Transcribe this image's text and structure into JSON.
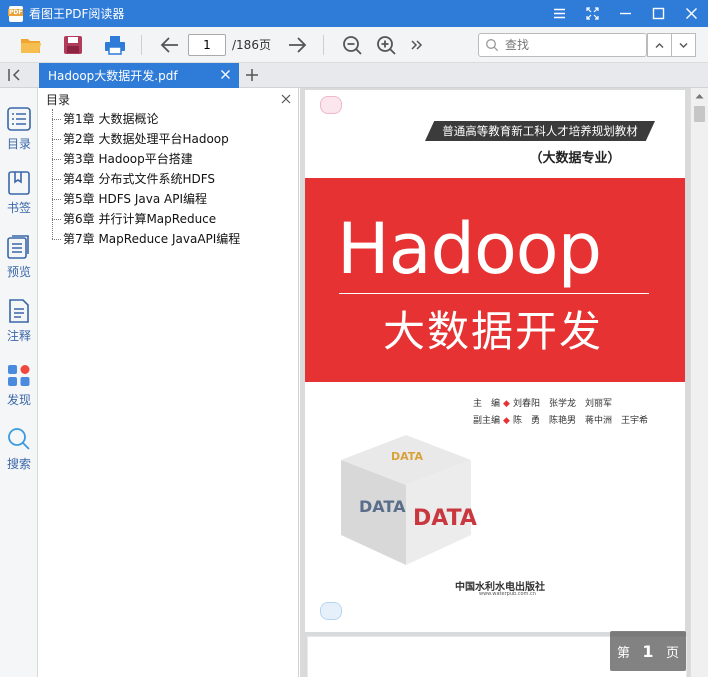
{
  "window": {
    "title": "看图王PDF阅读器",
    "logo_text": "PDF"
  },
  "toolbar": {
    "page_value": "1",
    "page_total": "/186页",
    "search_placeholder": "查找"
  },
  "tab": {
    "label": "Hadoop大数据开发.pdf"
  },
  "rail": {
    "items": [
      {
        "label": "目录"
      },
      {
        "label": "书签"
      },
      {
        "label": "预览"
      },
      {
        "label": "注释"
      },
      {
        "label": "发现"
      },
      {
        "label": "搜索"
      }
    ]
  },
  "outline": {
    "title": "目录",
    "items": [
      "第1章 大数据概论",
      "第2章 大数据处理平台Hadoop",
      "第3章 Hadoop平台搭建",
      "第4章 分布式文件系统HDFS",
      "第5章 HDFS Java API编程",
      "第6章 并行计算MapReduce",
      "第7章 MapReduce JavaAPI编程"
    ]
  },
  "cover": {
    "series": "普通高等教育新工科人才培养规划教材",
    "major": "（大数据专业）",
    "title_en": "Hadoop",
    "title_cn": "大数据开发",
    "chief_editor_label": "主　编",
    "chief_editors": "刘春阳　张学龙　刘丽军",
    "deputy_editor_label": "副主编",
    "deputy_editors": "陈　勇　陈艳男　蒋中洲　王宇希",
    "cube_text": "DATA",
    "publisher": "中国水利水电出版社",
    "publisher_url": "www.waterpub.com.cn"
  },
  "page_indicator": {
    "prefix": "第",
    "number": "1",
    "suffix": "页"
  },
  "colors": {
    "brand": "#2f7bd8",
    "cover_red": "#e63232"
  }
}
